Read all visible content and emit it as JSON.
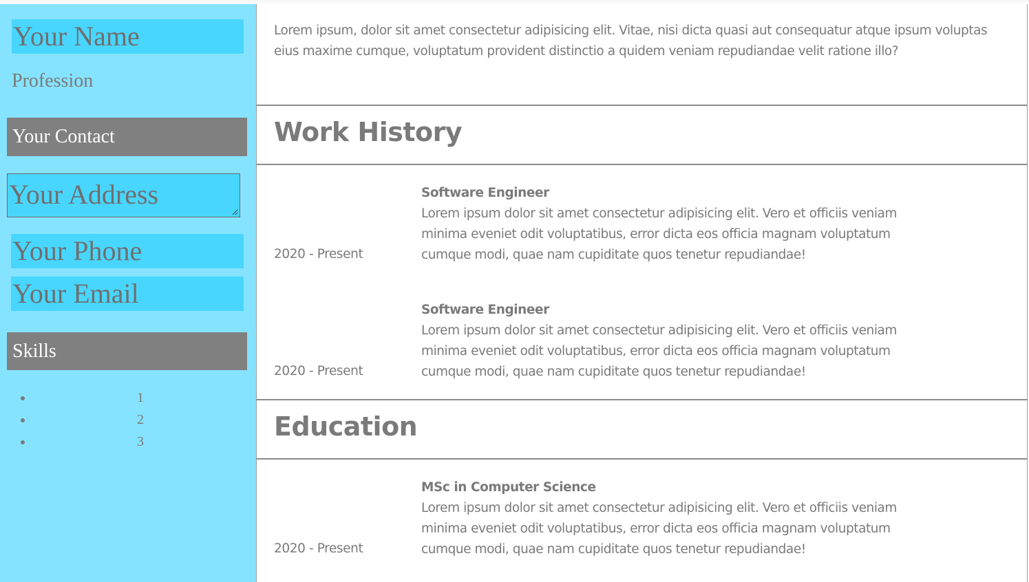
{
  "sidebar": {
    "name_value": "Your Name",
    "profession": "Profession",
    "contact_heading": "Your Contact",
    "address_value": "Your Address",
    "phone_value": "Your Phone",
    "email_value": "Your Email",
    "skills_heading": "Skills",
    "skills": [
      "1",
      "2",
      "3"
    ]
  },
  "main": {
    "intro": "Lorem ipsum, dolor sit amet consectetur adipisicing elit. Vitae, nisi dicta quasi aut consequatur atque ipsum voluptas eius maxime cumque, voluptatum provident distinctio a quidem veniam repudiandae velit ratione illo?",
    "work_heading": "Work History",
    "work": [
      {
        "date": "2020 - Present",
        "title": "Software Engineer",
        "description": "Lorem ipsum dolor sit amet consectetur adipisicing elit. Vero et officiis veniam minima eveniet odit voluptatibus, error dicta eos officia magnam voluptatum cumque modi, quae nam cupiditate quos tenetur repudiandae!"
      },
      {
        "date": "2020 - Present",
        "title": "Software Engineer",
        "description": "Lorem ipsum dolor sit amet consectetur adipisicing elit. Vero et officiis veniam minima eveniet odit voluptatibus, error dicta eos officia magnam voluptatum cumque modi, quae nam cupiditate quos tenetur repudiandae!"
      }
    ],
    "education_heading": "Education",
    "education": [
      {
        "date": "2020 - Present",
        "title": "MSc in Computer Science",
        "description": "Lorem ipsum dolor sit amet consectetur adipisicing elit. Vero et officiis veniam minima eveniet odit voluptatibus, error dicta eos officia magnam voluptatum cumque modi, quae nam cupiditate quos tenetur repudiandae!"
      }
    ]
  },
  "colors": {
    "sidebar_bg": "#86e3ff",
    "field_bg": "#48d6ff",
    "section_bar_bg": "#808080",
    "text": "#7a7a7a"
  }
}
